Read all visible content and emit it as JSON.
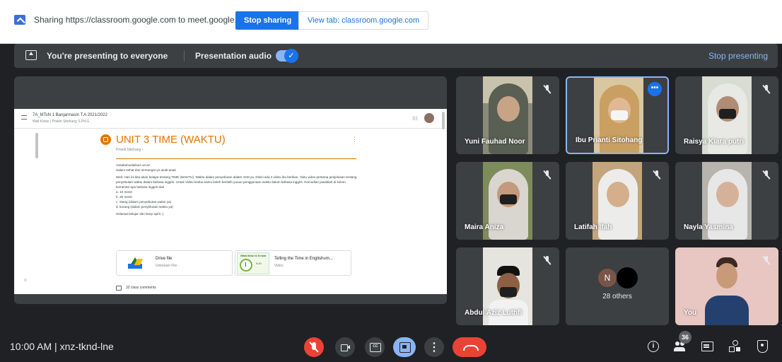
{
  "share_bar": {
    "message": "Sharing https://classroom.google.com to meet.google.com",
    "stop_sharing": "Stop sharing",
    "view_tab": "View tab: classroom.google.com"
  },
  "presenting_bar": {
    "label": "You're presenting to everyone",
    "audio_label": "Presentation audio",
    "audio_enabled": true,
    "stop_presenting": "Stop presenting"
  },
  "presentation": {
    "class_title": "7A_MTsN 1 Banjarmasin T.A 2021/2022",
    "class_subtitle": "Wali Kelas | Prianti Sitohang S.Pd.G",
    "post_title": "UNIT 3 TIME (WAKTU)",
    "post_author": "Prianti Sitohang •",
    "body": [
      "Assalamualaikum wr.wr.",
      "Salam sehat dan semangat ya anak-anak",
      "Well, Hari ini kita akan belajar tentang TIME (WAKTU). Waktu dalam penyebutan dalam JAM ya. Disini ada 2 video ibu berikan. Yaitu video pertama penjelasan tentang penyebutan waktu dalam bahasa inggris. Untuk Video kedua kamu boleh berlatih yuuuu penggunaan waktu dalam bahasa inggris. Kemudian jawablah di kolom komentar apa bahasa inggris dari",
      "a. 10 menit",
      "b. 30 menit",
      "c. Siang (dalam penyebutan waktu ya)",
      "d. kurang (dalam penyebutan waktu ya)",
      "Selamat belajar dan keep spirit :)"
    ],
    "attachments": [
      {
        "title": "Drive file",
        "subtitle": "Unknown File",
        "icon": "drive-icon"
      },
      {
        "title": "Telling the Time in Englishum...",
        "subtitle": "Video",
        "icon": "video-thumbnail",
        "thumb_title": "What time is it now",
        "thumb_time": "9:00"
      }
    ],
    "class_comments": "32 class comments"
  },
  "participants": [
    {
      "name": "Yuni Fauhad Noor",
      "muted": true
    },
    {
      "name": "Ibu Prianti Sitohang",
      "muted": false,
      "active": true
    },
    {
      "name": "Raisya Kiara putri",
      "muted": true
    },
    {
      "name": "Maira Aniza",
      "muted": true
    },
    {
      "name": "Latifah Ifah",
      "muted": true
    },
    {
      "name": "Nayla Yasmina",
      "muted": true
    },
    {
      "name": "Abdul Aziz Luthfi",
      "muted": true
    },
    {
      "name": "You",
      "muted": true
    }
  ],
  "others": {
    "initial": "N",
    "label": "28 others"
  },
  "bottom_bar": {
    "meeting_info": "10:00 AM | xnz-tknd-lne",
    "people_count": "36"
  },
  "colors": {
    "accent": "#1a73e8",
    "leave": "#ea4335",
    "classroom_orange": "#e37400",
    "dark_bg": "#202124",
    "tile_bg": "#3c4043"
  }
}
